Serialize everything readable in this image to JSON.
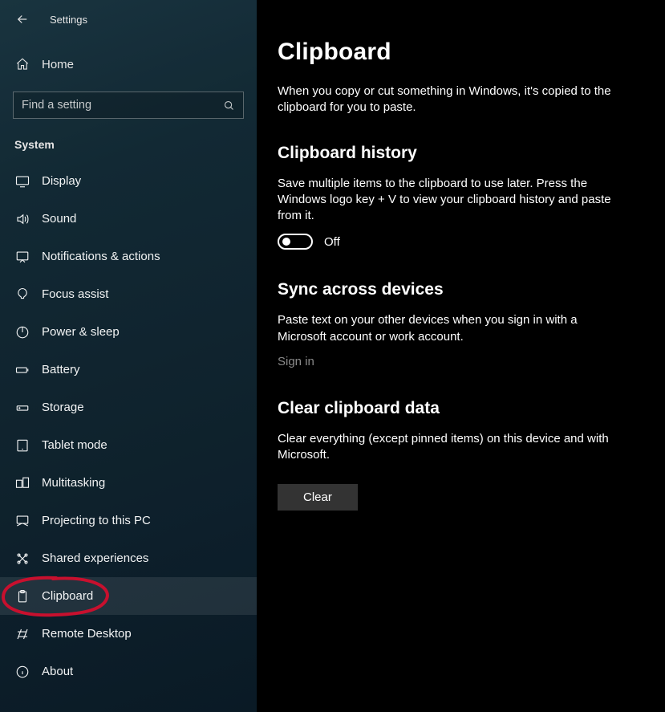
{
  "app": {
    "title": "Settings"
  },
  "sidebar": {
    "home_label": "Home",
    "search_placeholder": "Find a setting",
    "category": "System",
    "items": [
      {
        "label": "Display"
      },
      {
        "label": "Sound"
      },
      {
        "label": "Notifications & actions"
      },
      {
        "label": "Focus assist"
      },
      {
        "label": "Power & sleep"
      },
      {
        "label": "Battery"
      },
      {
        "label": "Storage"
      },
      {
        "label": "Tablet mode"
      },
      {
        "label": "Multitasking"
      },
      {
        "label": "Projecting to this PC"
      },
      {
        "label": "Shared experiences"
      },
      {
        "label": "Clipboard"
      },
      {
        "label": "Remote Desktop"
      },
      {
        "label": "About"
      }
    ]
  },
  "page": {
    "title": "Clipboard",
    "intro": "When you copy or cut something in Windows, it's copied to the clipboard for you to paste.",
    "history": {
      "heading": "Clipboard history",
      "desc": "Save multiple items to the clipboard to use later. Press the Windows logo key + V to view your clipboard history and paste from it.",
      "toggle_state": "Off"
    },
    "sync": {
      "heading": "Sync across devices",
      "desc": "Paste text on your other devices when you sign in with a Microsoft account or work account.",
      "signin": "Sign in"
    },
    "clear": {
      "heading": "Clear clipboard data",
      "desc": "Clear everything (except pinned items) on this device and with Microsoft.",
      "button": "Clear"
    }
  }
}
